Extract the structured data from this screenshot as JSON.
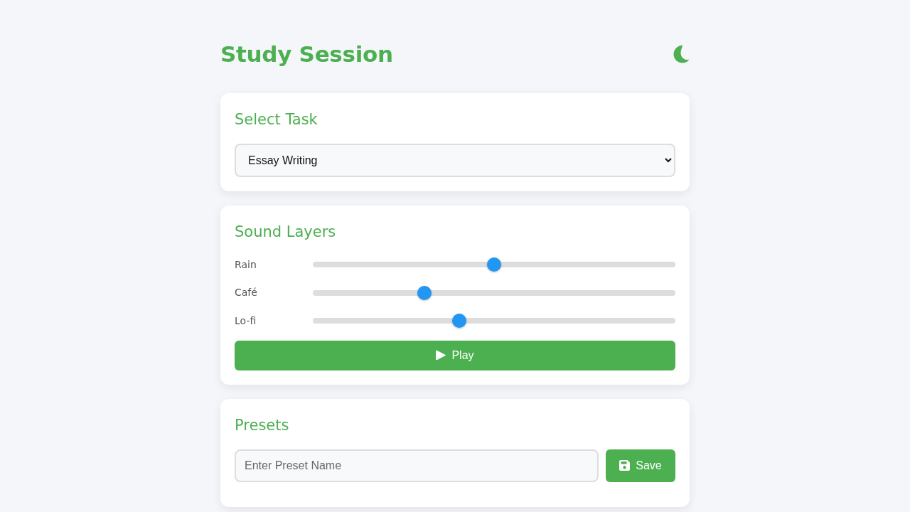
{
  "header": {
    "title": "Study Session"
  },
  "task_card": {
    "heading": "Select Task",
    "task_select": {
      "value": "Essay Writing"
    }
  },
  "sound_card": {
    "heading": "Sound Layers",
    "layers": [
      {
        "name": "Rain",
        "level": 0.5
      },
      {
        "name": "Café",
        "level": 0.3
      },
      {
        "name": "Lo-fi",
        "level": 0.4
      }
    ],
    "play_button": {
      "label": "Play"
    }
  },
  "presets_card": {
    "heading": "Presets",
    "name_field": {
      "placeholder": "Enter Preset Name"
    },
    "save_button": {
      "label": "Save"
    }
  }
}
